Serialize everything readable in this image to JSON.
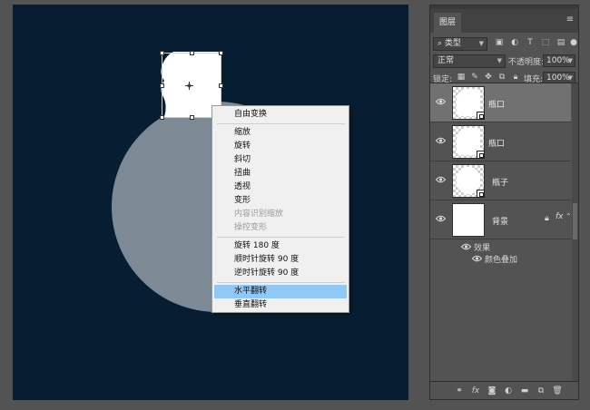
{
  "context_menu": {
    "items": [
      {
        "label": "自由变换",
        "state": "normal"
      },
      {
        "label": "缩放",
        "state": "normal"
      },
      {
        "label": "旋转",
        "state": "normal"
      },
      {
        "label": "斜切",
        "state": "normal"
      },
      {
        "label": "扭曲",
        "state": "normal"
      },
      {
        "label": "透视",
        "state": "normal"
      },
      {
        "label": "变形",
        "state": "normal"
      },
      {
        "label": "内容识别缩放",
        "state": "disabled"
      },
      {
        "label": "操控变形",
        "state": "disabled"
      },
      {
        "label": "旋转 180 度",
        "state": "normal"
      },
      {
        "label": "顺时针旋转 90 度",
        "state": "normal"
      },
      {
        "label": "逆时针旋转 90 度",
        "state": "normal"
      },
      {
        "label": "水平翻转",
        "state": "highlighted"
      },
      {
        "label": "垂直翻转",
        "state": "normal"
      }
    ]
  },
  "layers_panel": {
    "tab_label": "图层",
    "filter": {
      "label": "类型"
    },
    "blend_mode": "正常",
    "opacity_label": "不透明度:",
    "opacity_value": "100%",
    "lock_label": "锁定:",
    "fill_label": "填充:",
    "fill_value": "100%",
    "layers": [
      {
        "name": "瓶口",
        "selected": true
      },
      {
        "name": "瓶口",
        "selected": false
      },
      {
        "name": "瓶子",
        "selected": false
      },
      {
        "name": "背景",
        "selected": false
      }
    ],
    "effects": {
      "label": "效果",
      "items": [
        "颜色叠加"
      ]
    }
  },
  "colors": {
    "canvas_bg": "#071e32",
    "circle": "#7d8a96",
    "menu_highlight": "#90c8f6",
    "selected_layer": "#717171"
  }
}
